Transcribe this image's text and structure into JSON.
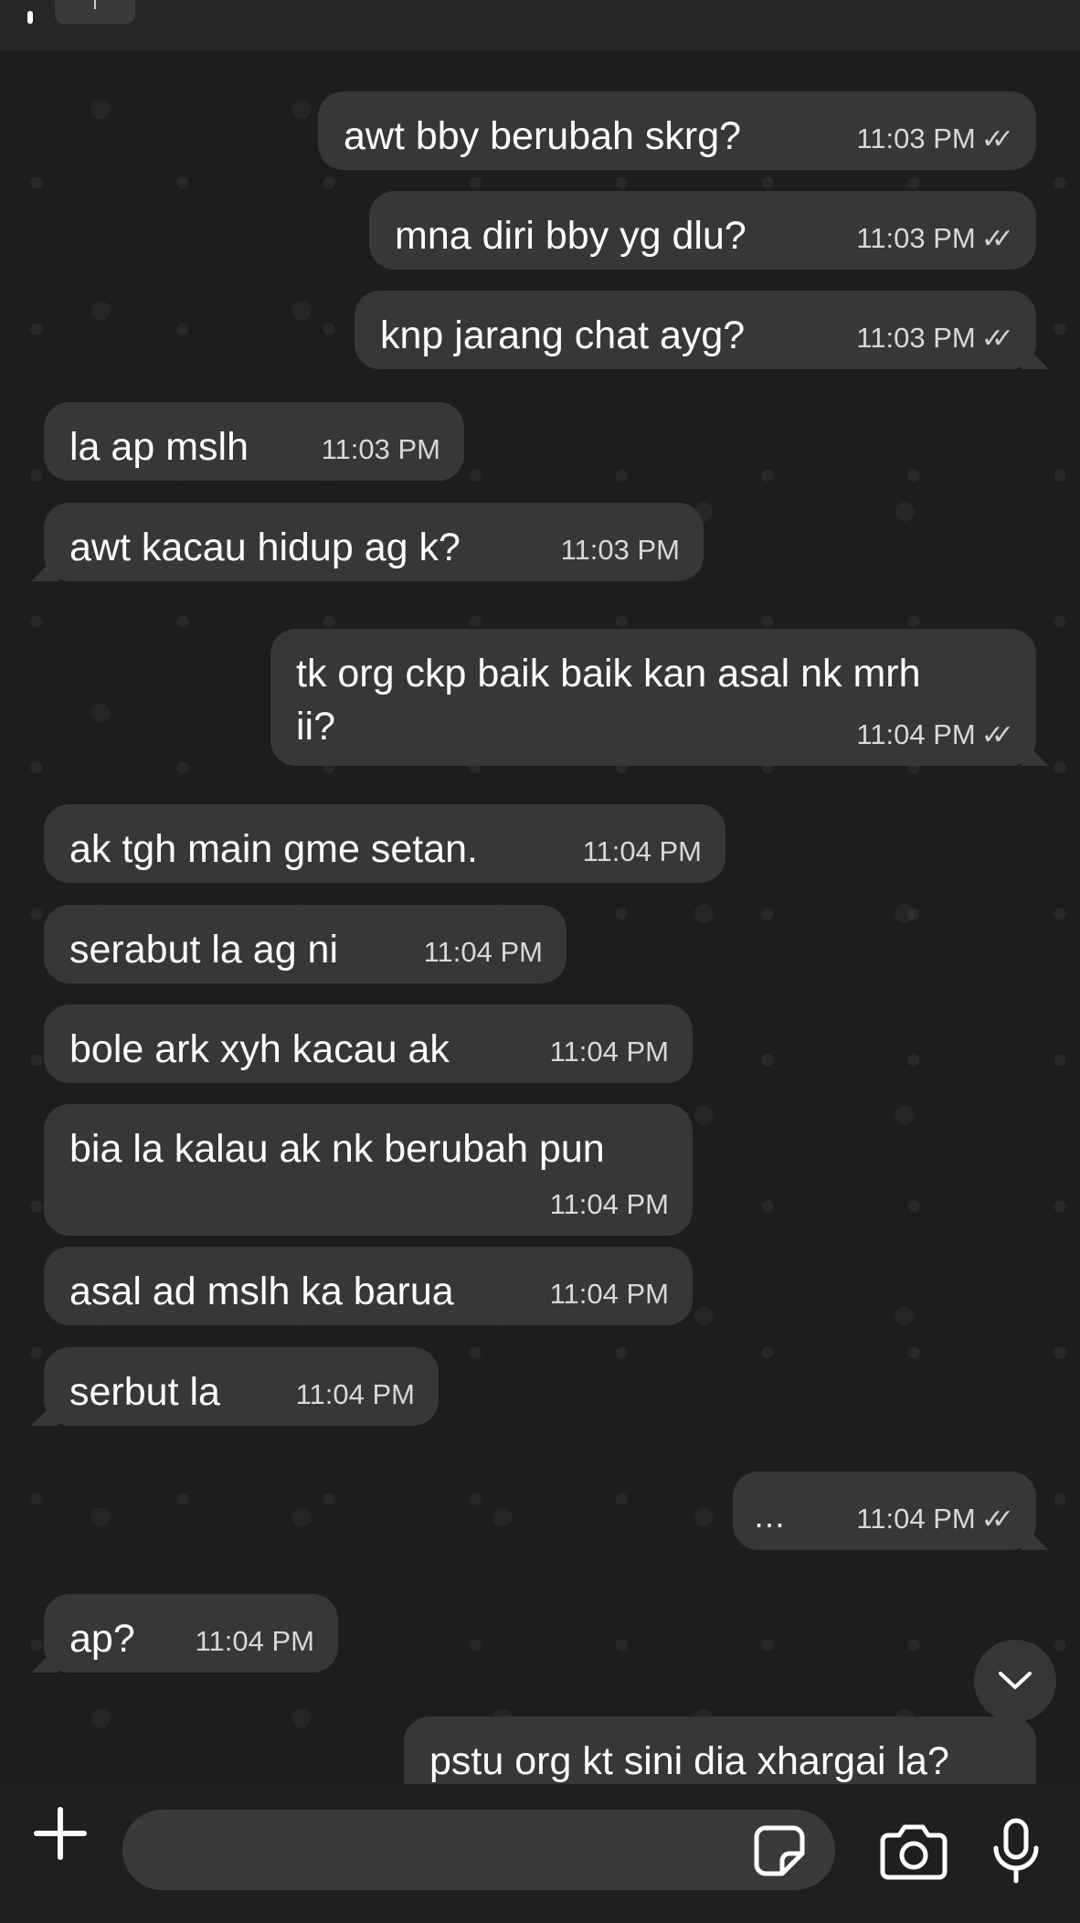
{
  "messages": [
    {
      "dir": "out",
      "text": "awt bby berubah skrg?",
      "time": "11:03 PM",
      "status": "read"
    },
    {
      "dir": "out",
      "text": "mna diri bby yg dlu?",
      "time": "11:03 PM",
      "status": "read"
    },
    {
      "dir": "out",
      "text": "knp jarang chat ayg?",
      "time": "11:03 PM",
      "status": "read"
    },
    {
      "dir": "in",
      "text": "la ap mslh",
      "time": "11:03 PM"
    },
    {
      "dir": "in",
      "text": "awt kacau hidup ag k?",
      "time": "11:03 PM"
    },
    {
      "dir": "out",
      "text_line1": "tk org ckp baik baik kan asal nk mrh",
      "text_line2": "ii?",
      "time": "11:04 PM",
      "status": "read"
    },
    {
      "dir": "in",
      "text": "ak tgh main gme setan.",
      "time": "11:04 PM"
    },
    {
      "dir": "in",
      "text": "serabut la ag ni",
      "time": "11:04 PM"
    },
    {
      "dir": "in",
      "text": "bole ark xyh kacau ak",
      "time": "11:04 PM"
    },
    {
      "dir": "in",
      "text": "bia la kalau ak nk berubah pun",
      "time": "11:04 PM"
    },
    {
      "dir": "in",
      "text": "asal ad mslh ka barua",
      "time": "11:04 PM"
    },
    {
      "dir": "in",
      "text": "serbut la",
      "time": "11:04 PM"
    },
    {
      "dir": "out",
      "text": "…",
      "time": "11:04 PM",
      "status": "read"
    },
    {
      "dir": "in",
      "text": "ap?",
      "time": "11:04 PM"
    },
    {
      "dir": "out",
      "text": "pstu org kt sini dia xhargai la?",
      "time": "",
      "status": ""
    }
  ],
  "read_tick_glyph": "✓✓",
  "composer": {
    "placeholder": ""
  },
  "icons": {
    "plus": "plus-icon",
    "sticker": "sticker-icon",
    "camera": "camera-icon",
    "mic": "microphone-icon",
    "scroll": "chevron-down-icon"
  },
  "colors": {
    "bubble": "#373737",
    "background": "#1d1d1d",
    "text": "#ffffff",
    "meta": "#d8d8d8"
  }
}
